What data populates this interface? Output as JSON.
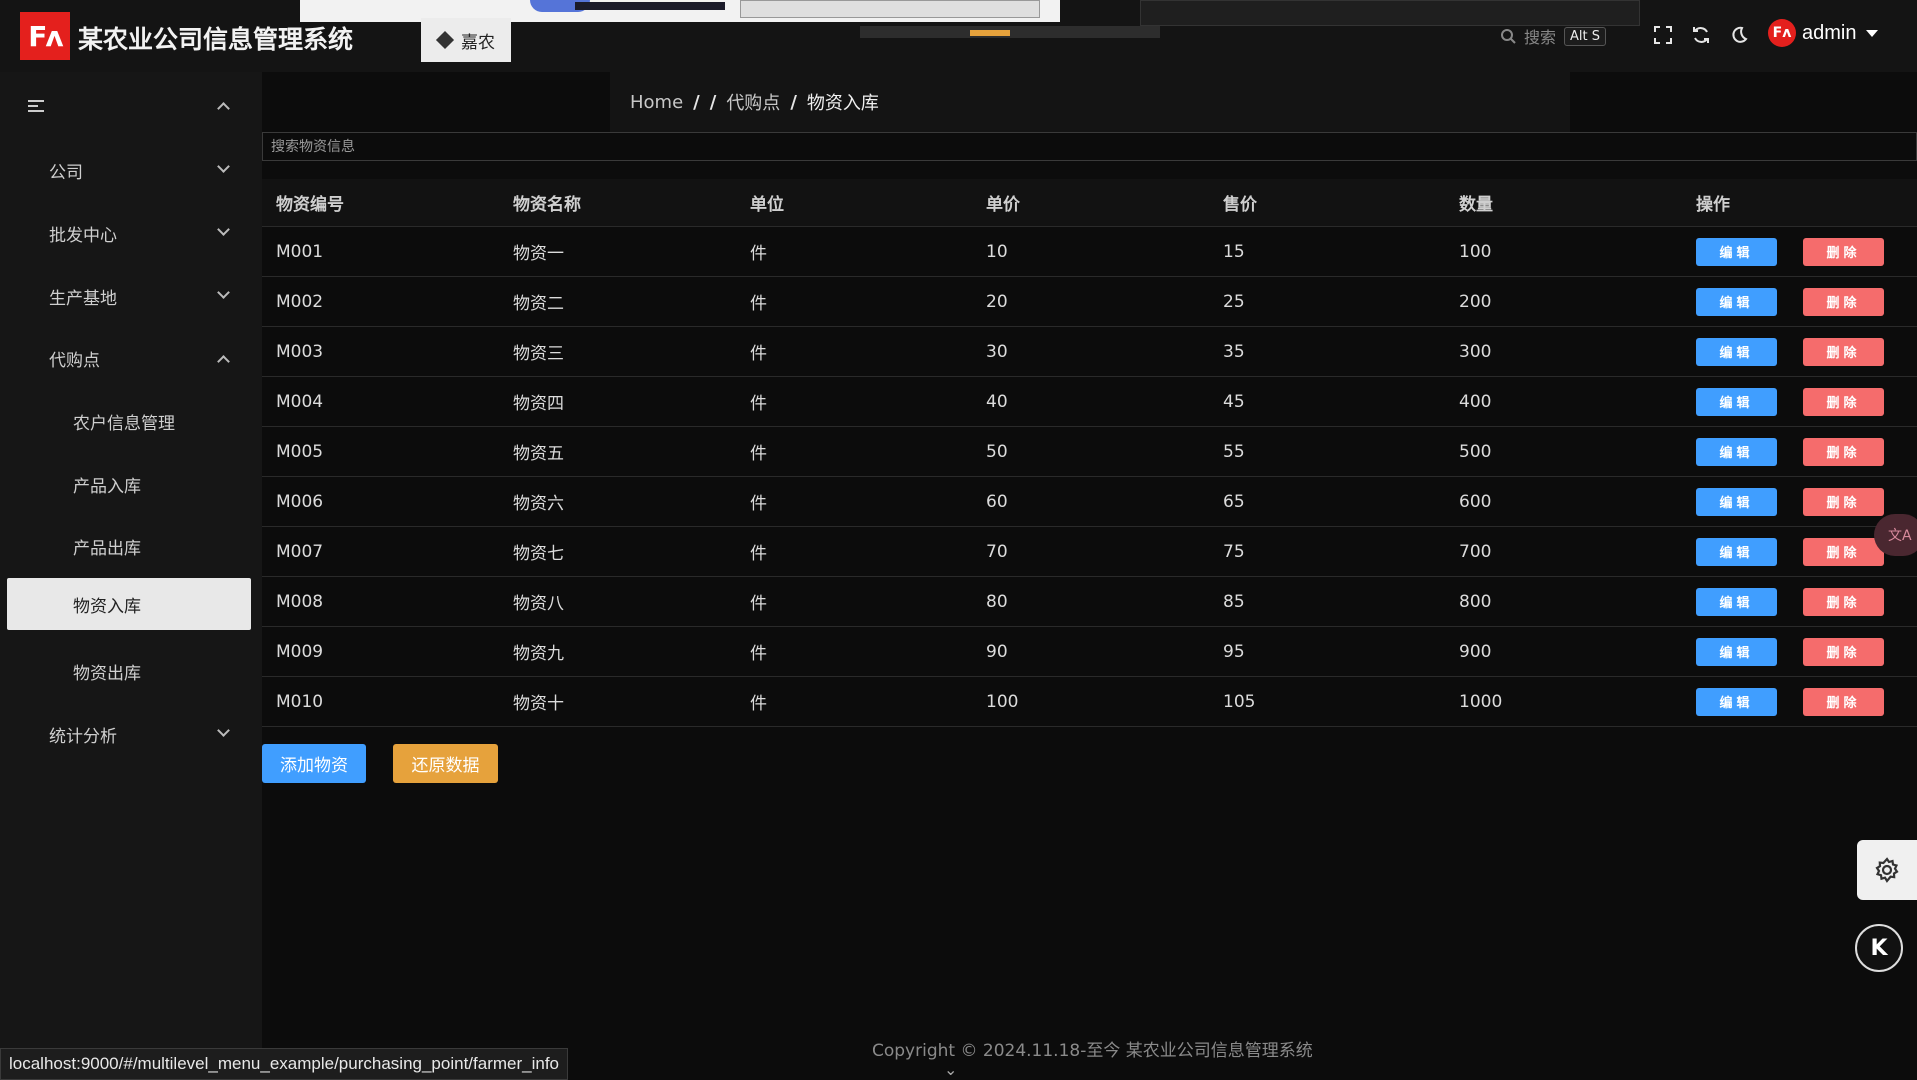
{
  "header": {
    "logo_text": "Fʌ",
    "app_title": "某农业公司信息管理系统",
    "tab_label": "嘉农",
    "search_placeholder": "搜索",
    "search_shortcut": "Alt S",
    "user_avatar_text": "Fʌ",
    "username": "admin"
  },
  "sidebar": {
    "items": [
      {
        "label": "公司"
      },
      {
        "label": "批发中心"
      },
      {
        "label": "生产基地"
      },
      {
        "label": "代购点"
      },
      {
        "label": "农户信息管理"
      },
      {
        "label": "产品入库"
      },
      {
        "label": "产品出库"
      },
      {
        "label": "物资入库"
      },
      {
        "label": "物资出库"
      },
      {
        "label": "统计分析"
      }
    ]
  },
  "breadcrumb": {
    "home": "Home",
    "level2": "代购点",
    "current": "物资入库"
  },
  "search": {
    "placeholder": "搜索物资信息"
  },
  "table": {
    "headers": [
      "物资编号",
      "物资名称",
      "单位",
      "单价",
      "售价",
      "数量",
      "操作"
    ],
    "edit_label": "编辑",
    "delete_label": "删除",
    "rows": [
      [
        "M001",
        "物资一",
        "件",
        "10",
        "15",
        "100"
      ],
      [
        "M002",
        "物资二",
        "件",
        "20",
        "25",
        "200"
      ],
      [
        "M003",
        "物资三",
        "件",
        "30",
        "35",
        "300"
      ],
      [
        "M004",
        "物资四",
        "件",
        "40",
        "45",
        "400"
      ],
      [
        "M005",
        "物资五",
        "件",
        "50",
        "55",
        "500"
      ],
      [
        "M006",
        "物资六",
        "件",
        "60",
        "65",
        "600"
      ],
      [
        "M007",
        "物资七",
        "件",
        "70",
        "75",
        "700"
      ],
      [
        "M008",
        "物资八",
        "件",
        "80",
        "85",
        "800"
      ],
      [
        "M009",
        "物资九",
        "件",
        "90",
        "95",
        "900"
      ],
      [
        "M010",
        "物资十",
        "件",
        "100",
        "105",
        "1000"
      ]
    ]
  },
  "actions": {
    "add_label": "添加物资",
    "restore_label": "还原数据"
  },
  "footer": {
    "text": "Copyright © 2024.11.18-至今  某农业公司信息管理系统"
  },
  "statusbar": {
    "url": "localhost:9000/#/multilevel_menu_example/purchasing_point/farmer_info"
  },
  "colors": {
    "primary": "#409eff",
    "danger": "#f56c6c",
    "warning": "#e6a23c",
    "brand": "#e4201d"
  }
}
